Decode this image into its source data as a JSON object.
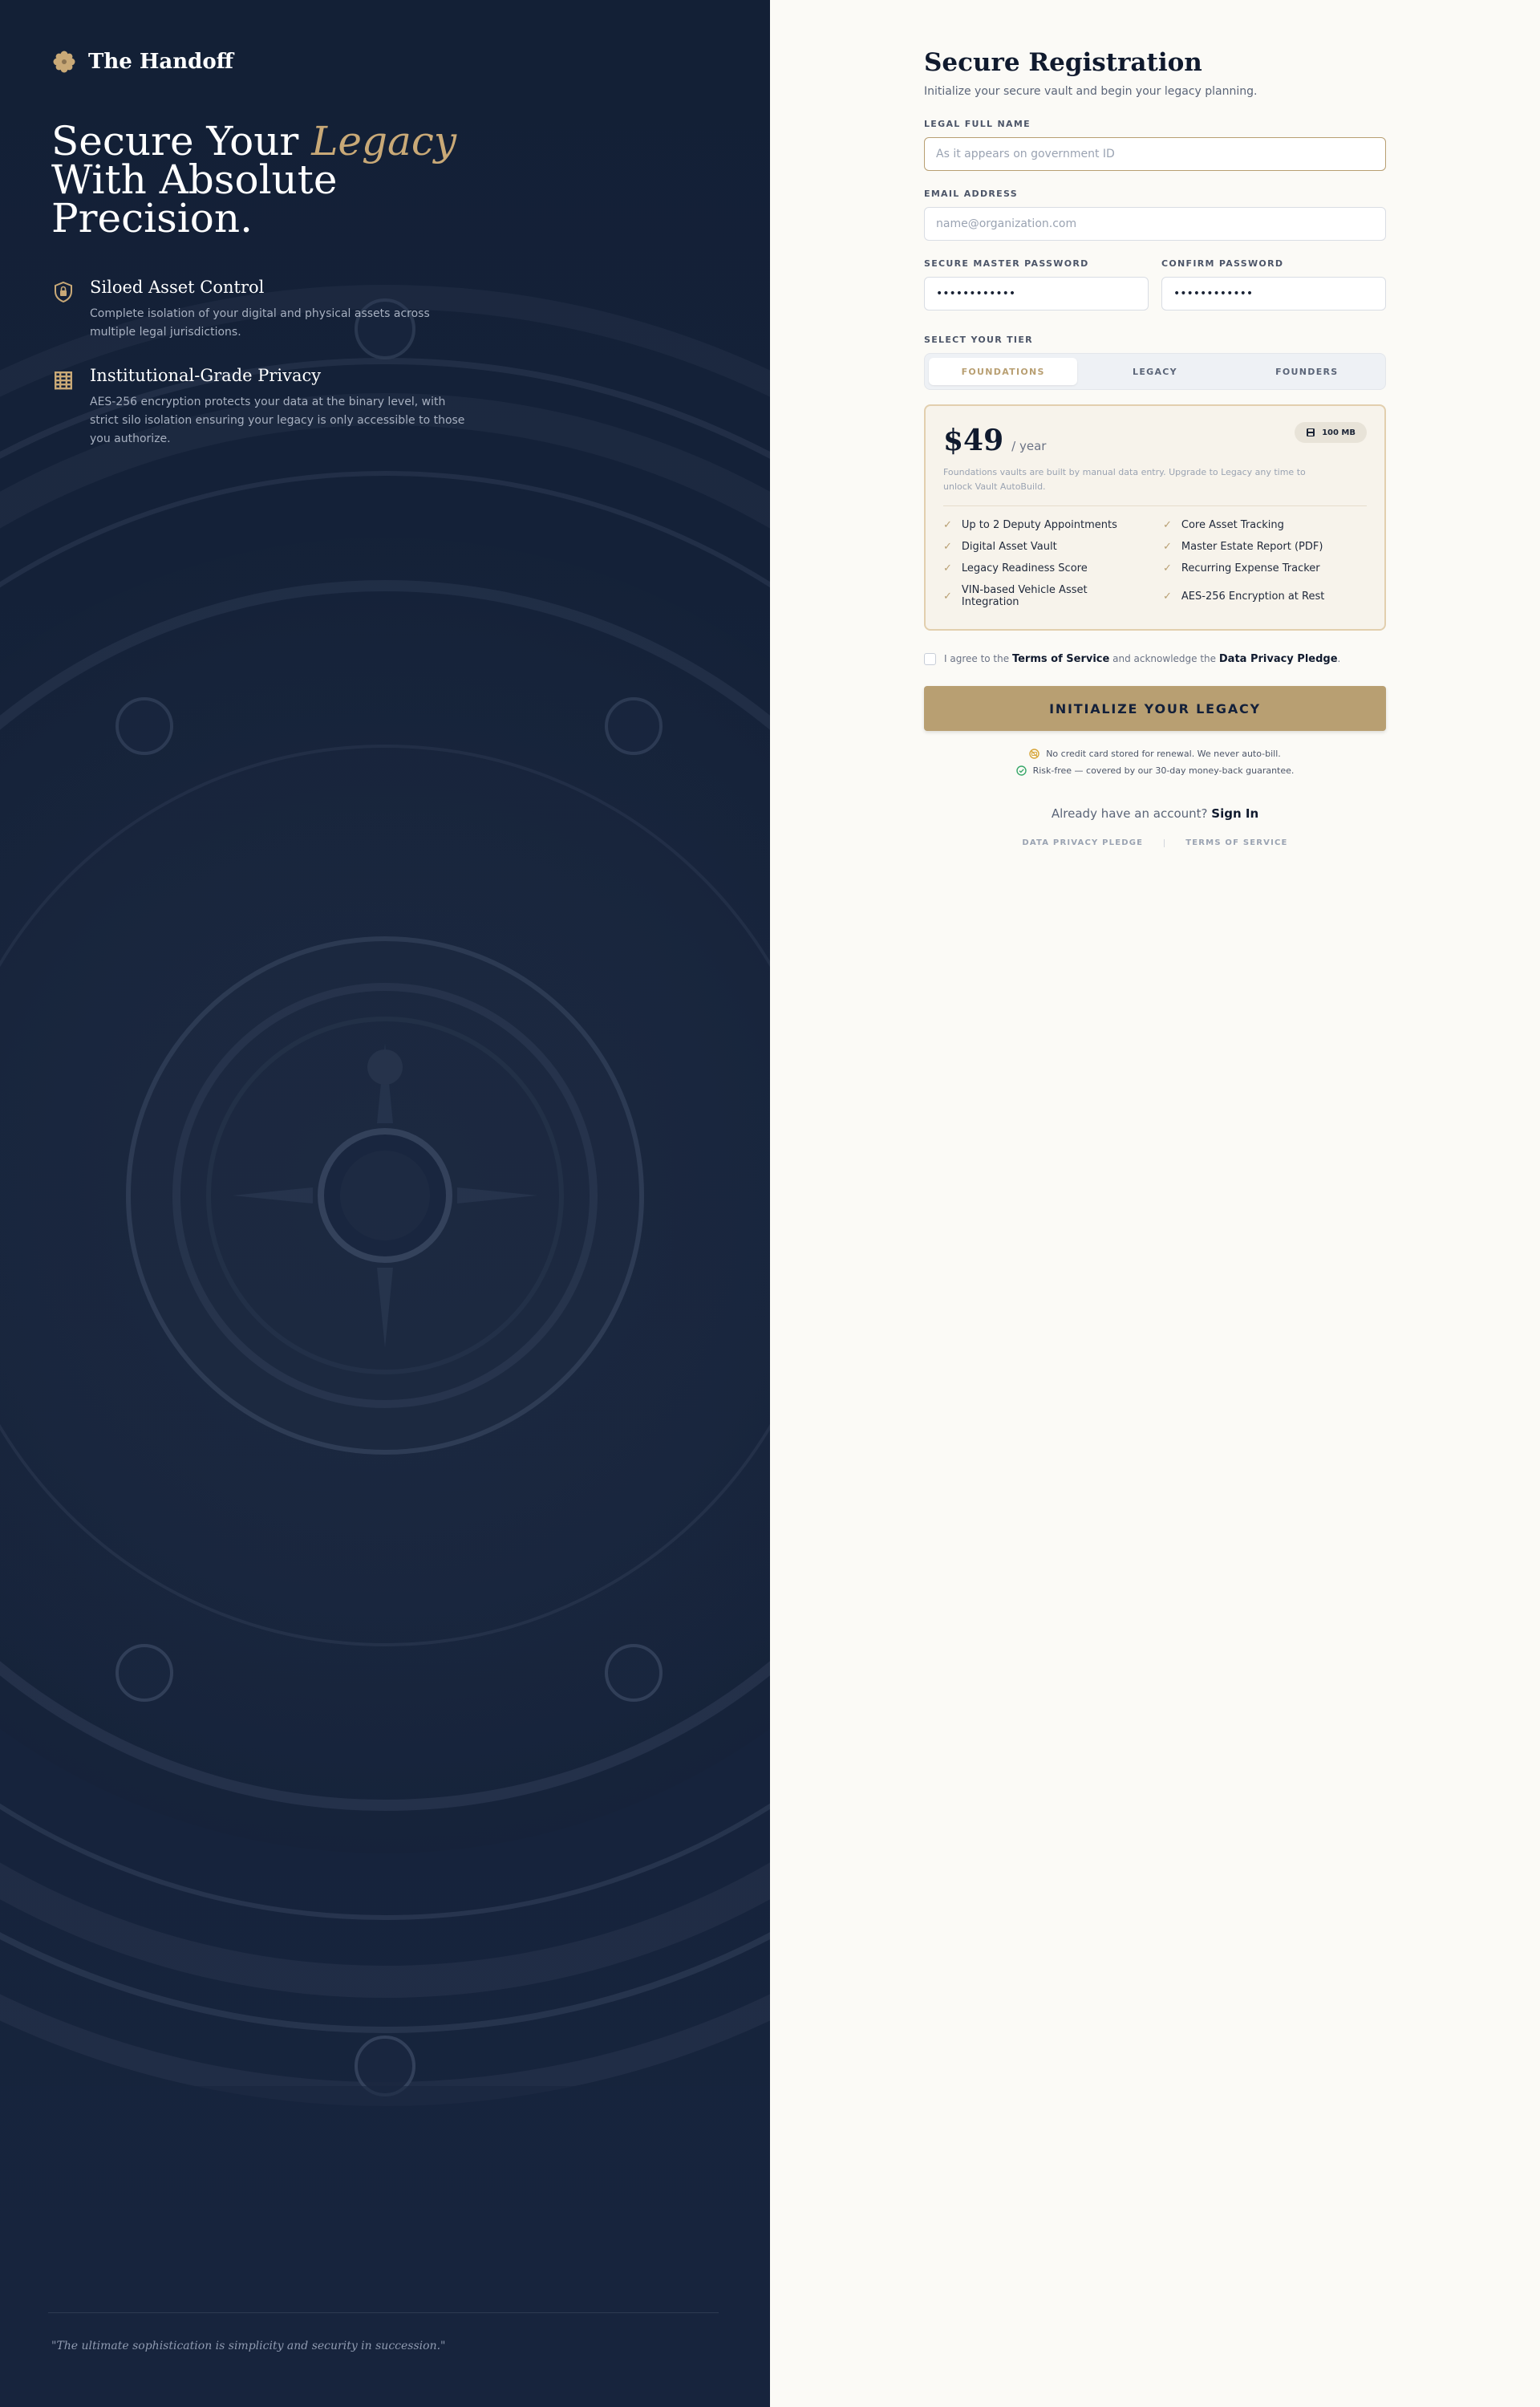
{
  "brand": {
    "name": "The Handoff",
    "icon": "gear-flower-icon",
    "accent": "#c9a977"
  },
  "hero": {
    "line1": "Secure Your ",
    "accent": "Legacy",
    "line2": "With Absolute",
    "line3": "Precision."
  },
  "features": [
    {
      "icon": "shield-lock-icon",
      "title": "Siloed Asset Control",
      "desc": "Complete isolation of your digital and physical assets across multiple legal jurisdictions."
    },
    {
      "icon": "grid-lock-icon",
      "title": "Institutional-Grade Privacy",
      "desc": "AES-256 encryption protects your data at the binary level, with strict silo isolation ensuring your legacy is only accessible to those you authorize."
    }
  ],
  "quote": "\"The ultimate sophistication is simplicity and security in succession.\"",
  "form": {
    "title": "Secure Registration",
    "subtitle": "Initialize your secure vault and begin your legacy planning.",
    "full_name": {
      "label": "LEGAL FULL NAME",
      "placeholder": "As it appears on government ID",
      "value": ""
    },
    "email": {
      "label": "EMAIL ADDRESS",
      "placeholder": "name@organization.com",
      "value": ""
    },
    "password": {
      "label": "SECURE MASTER PASSWORD",
      "value": "••••••••••••"
    },
    "confirm": {
      "label": "CONFIRM PASSWORD",
      "value": "••••••••••••"
    },
    "tier_label": "SELECT YOUR TIER",
    "tiers": [
      "FOUNDATIONS",
      "LEGACY",
      "FOUNDERS"
    ],
    "selected_tier": "FOUNDATIONS"
  },
  "plan": {
    "price": "$49",
    "period": "/ year",
    "storage": "100 MB",
    "note": "Foundations vaults are built by manual data entry. Upgrade to Legacy any time to unlock Vault AutoBuild.",
    "features": [
      "Up to 2 Deputy Appointments",
      "Core Asset Tracking",
      "Digital Asset Vault",
      "Master Estate Report (PDF)",
      "Legacy Readiness Score",
      "Recurring Expense Tracker",
      "VIN-based Vehicle Asset Integration",
      "AES-256 Encryption at Rest"
    ]
  },
  "agreement": {
    "prefix": "I agree to the",
    "terms": "Terms of Service",
    "middle": "and acknowledge the",
    "pledge": "Data Privacy Pledge",
    "suffix": "."
  },
  "cta": "INITIALIZE YOUR LEGACY",
  "guarantees": [
    {
      "icon": "no-card-icon",
      "text": "No credit card stored for renewal. We never auto-bill."
    },
    {
      "icon": "check-circle-icon",
      "text": "Risk-free — covered by our 30-day money-back guarantee."
    }
  ],
  "signin": {
    "prompt": "Already have an account?",
    "link": "Sign In"
  },
  "footer_links": [
    "DATA PRIVACY PLEDGE",
    "TERMS OF SERVICE"
  ],
  "colors": {
    "navy": "#132036",
    "gold": "#b89f72",
    "cream": "#fbfaf6"
  }
}
